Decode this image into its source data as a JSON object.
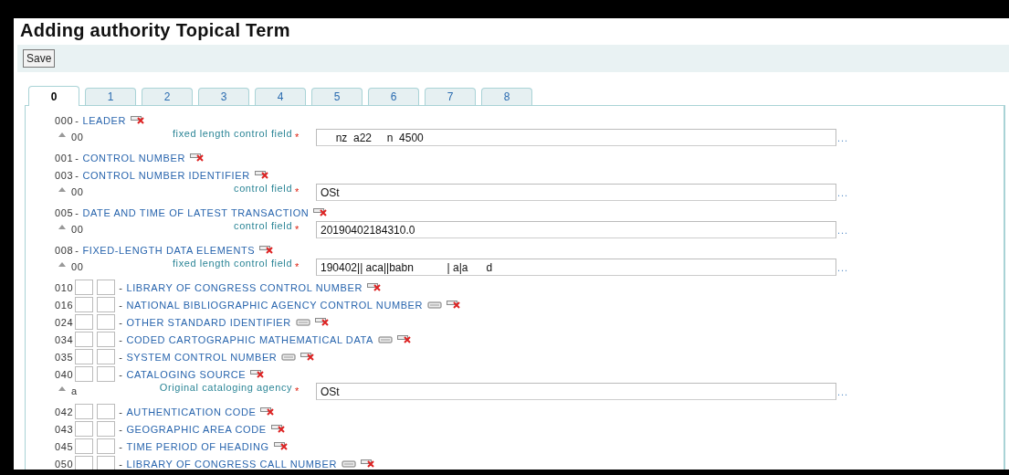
{
  "page_title": "Adding authority Topical Term",
  "toolbar": {
    "save_button": "Save"
  },
  "tabs": [
    {
      "label": "0",
      "selected": true
    },
    {
      "label": "1",
      "selected": false
    },
    {
      "label": "2",
      "selected": false
    },
    {
      "label": "3",
      "selected": false
    },
    {
      "label": "4",
      "selected": false
    },
    {
      "label": "5",
      "selected": false
    },
    {
      "label": "6",
      "selected": false
    },
    {
      "label": "7",
      "selected": false
    },
    {
      "label": "8",
      "selected": false
    }
  ],
  "fields": [
    {
      "tag": "000",
      "separator": "-",
      "name": "LEADER",
      "indicators": false,
      "repeatable": false,
      "subfields": [
        {
          "code": "00",
          "label": "fixed length control field",
          "required_mark": "*",
          "value": "     nz  a22     n  4500",
          "plugin": "..."
        }
      ]
    },
    {
      "tag": "001",
      "separator": "-",
      "name": "CONTROL NUMBER",
      "indicators": false,
      "repeatable": false
    },
    {
      "tag": "003",
      "separator": "-",
      "name": "CONTROL NUMBER IDENTIFIER",
      "indicators": false,
      "repeatable": false,
      "subfields": [
        {
          "code": "00",
          "label": "control field",
          "required_mark": "*",
          "value": "OSt",
          "plugin": "..."
        }
      ]
    },
    {
      "tag": "005",
      "separator": "-",
      "name": "DATE AND TIME OF LATEST TRANSACTION",
      "indicators": false,
      "repeatable": false,
      "subfields": [
        {
          "code": "00",
          "label": "control field",
          "required_mark": "*",
          "value": "20190402184310.0",
          "plugin": "..."
        }
      ]
    },
    {
      "tag": "008",
      "separator": "-",
      "name": "FIXED-LENGTH DATA ELEMENTS",
      "indicators": false,
      "repeatable": false,
      "subfields": [
        {
          "code": "00",
          "label": "fixed length control field",
          "required_mark": "*",
          "value": "190402|| aca||babn           | a|a      d",
          "plugin": "..."
        }
      ]
    },
    {
      "tag": "010",
      "separator": "-",
      "name": "LIBRARY OF CONGRESS CONTROL NUMBER",
      "indicators": true,
      "repeatable": false
    },
    {
      "tag": "016",
      "separator": "-",
      "name": "NATIONAL BIBLIOGRAPHIC AGENCY CONTROL NUMBER",
      "indicators": true,
      "repeatable": true
    },
    {
      "tag": "024",
      "separator": "-",
      "name": "OTHER STANDARD IDENTIFIER",
      "indicators": true,
      "repeatable": true
    },
    {
      "tag": "034",
      "separator": "-",
      "name": "CODED CARTOGRAPHIC MATHEMATICAL DATA",
      "indicators": true,
      "repeatable": true
    },
    {
      "tag": "035",
      "separator": "-",
      "name": "SYSTEM CONTROL NUMBER",
      "indicators": true,
      "repeatable": true
    },
    {
      "tag": "040",
      "separator": "-",
      "name": "CATALOGING SOURCE",
      "indicators": true,
      "repeatable": false,
      "subfields": [
        {
          "code": "a",
          "label": "Original cataloging agency",
          "required_mark": "*",
          "value": "OSt",
          "plugin": "..."
        }
      ]
    },
    {
      "tag": "042",
      "separator": "-",
      "name": "AUTHENTICATION CODE",
      "indicators": true,
      "repeatable": false
    },
    {
      "tag": "043",
      "separator": "-",
      "name": "GEOGRAPHIC AREA CODE",
      "indicators": true,
      "repeatable": false
    },
    {
      "tag": "045",
      "separator": "-",
      "name": "TIME PERIOD OF HEADING",
      "indicators": true,
      "repeatable": false
    },
    {
      "tag": "050",
      "separator": "-",
      "name": "LIBRARY OF CONGRESS CALL NUMBER",
      "indicators": true,
      "repeatable": true
    }
  ]
}
